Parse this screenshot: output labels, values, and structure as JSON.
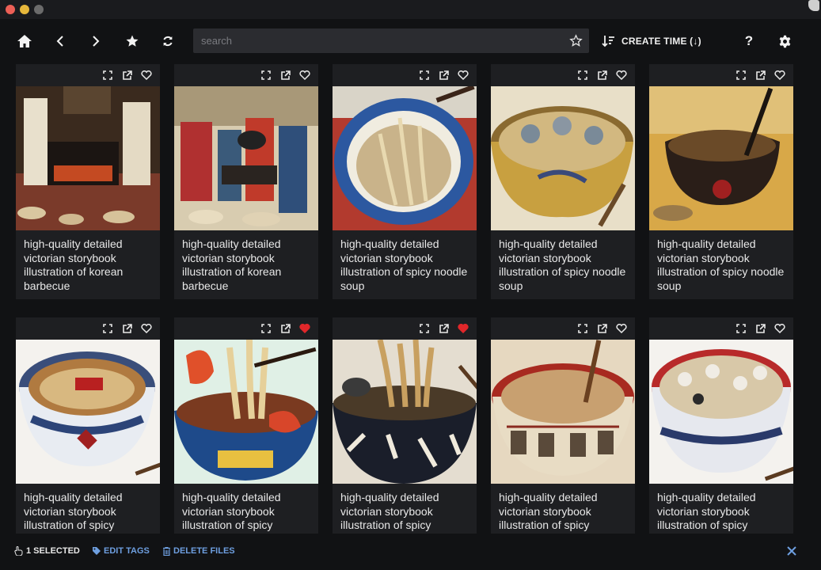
{
  "window": {
    "traffic_lights": [
      "#ec5f56",
      "#e6b73b",
      "#6b6b6b"
    ]
  },
  "toolbar": {
    "search_placeholder": "search",
    "sort_label": "CREATE TIME (↓)",
    "help_label": "?",
    "icons": [
      "home-icon",
      "back-icon",
      "forward-icon",
      "favorites-star-icon",
      "refresh-icon",
      "sort-icon",
      "gear-icon"
    ]
  },
  "cards": [
    {
      "caption": "high-quality detailed victorian storybook illustration of korean barbecue",
      "favorited": false,
      "scene": "bbq1"
    },
    {
      "caption": "high-quality detailed victorian storybook illustration of korean barbecue",
      "favorited": false,
      "scene": "bbq2"
    },
    {
      "caption": "high-quality detailed victorian storybook illustration of spicy noodle soup",
      "favorited": false,
      "scene": "blue"
    },
    {
      "caption": "high-quality detailed victorian storybook illustration of spicy noodle soup",
      "favorited": false,
      "scene": "gold"
    },
    {
      "caption": "high-quality detailed victorian storybook illustration of spicy noodle soup",
      "favorited": false,
      "scene": "dark"
    },
    {
      "caption": "high-quality detailed victorian storybook illustration of spicy",
      "favorited": false,
      "scene": "white"
    },
    {
      "caption": "high-quality detailed victorian storybook illustration of spicy",
      "favorited": true,
      "scene": "shrimp"
    },
    {
      "caption": "high-quality detailed victorian storybook illustration of spicy",
      "favorited": true,
      "scene": "ink"
    },
    {
      "caption": "high-quality detailed victorian storybook illustration of spicy",
      "favorited": false,
      "scene": "red"
    },
    {
      "caption": "high-quality detailed victorian storybook illustration of spicy",
      "favorited": false,
      "scene": "mush"
    }
  ],
  "bottom_bar": {
    "selected_label": "1 SELECTED",
    "edit_tags_label": "EDIT TAGS",
    "delete_files_label": "DELETE FILES"
  },
  "colors": {
    "background": "#111214",
    "card": "#1e1f22",
    "accent": "#6e9fe0",
    "favorite": "#e0272a"
  }
}
